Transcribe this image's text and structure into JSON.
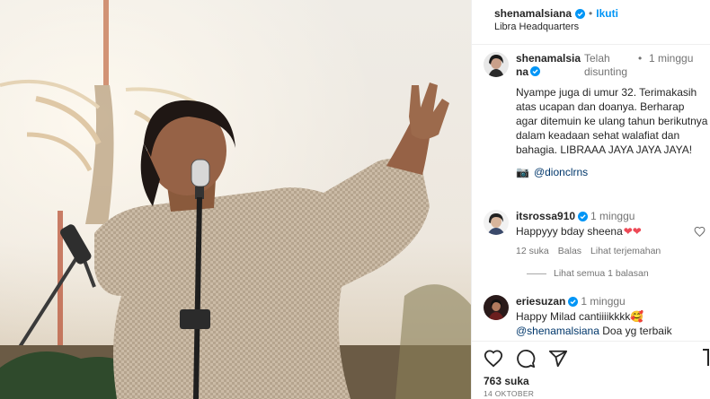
{
  "post": {
    "username": "shenamalsiana",
    "follow_label": "Ikuti",
    "separator": "•",
    "location": "Libra Headquarters"
  },
  "caption": {
    "username": "shenamalsiana",
    "edited_label": "Telah disunting",
    "separator": "•",
    "time": "1 minggu",
    "text": "Nyampe juga di umur 32. Terimakasih atas ucapan dan doanya. Berharap agar ditemuin ke ulang tahun berikutnya dalam keadaan sehat walafiat dan bahagia. LIBRAAA JAYA JAYA JAYA!",
    "credit_emoji": "📷",
    "credit": "@dionclrns"
  },
  "comments": [
    {
      "username": "itsrossa910",
      "time": "1 minggu",
      "text": "Happyyy bday sheena",
      "hearts": "❤❤",
      "likes": "12 suka",
      "reply_label": "Balas",
      "translate_label": "Lihat terjemahan"
    },
    {
      "username": "eriesuzan",
      "time": "1 minggu",
      "text_line1": "Happy Milad cantiiiikkkk",
      "emoji": "🥰",
      "mention": "@shenamalsiana",
      "text_line2": " Doa yg terbaik"
    }
  ],
  "view_replies": "Lihat semua 1 balasan",
  "likes_count": "763 suka",
  "date": "14 OKTOBER",
  "colors": {
    "accent": "#0095f6",
    "verified": "#0095f6",
    "heart": "#ed4956",
    "link": "#00376b",
    "muted": "#737373"
  },
  "icons": [
    "verified-icon",
    "camera-icon",
    "heart-icon",
    "comment-icon",
    "share-icon",
    "bookmark-icon"
  ]
}
